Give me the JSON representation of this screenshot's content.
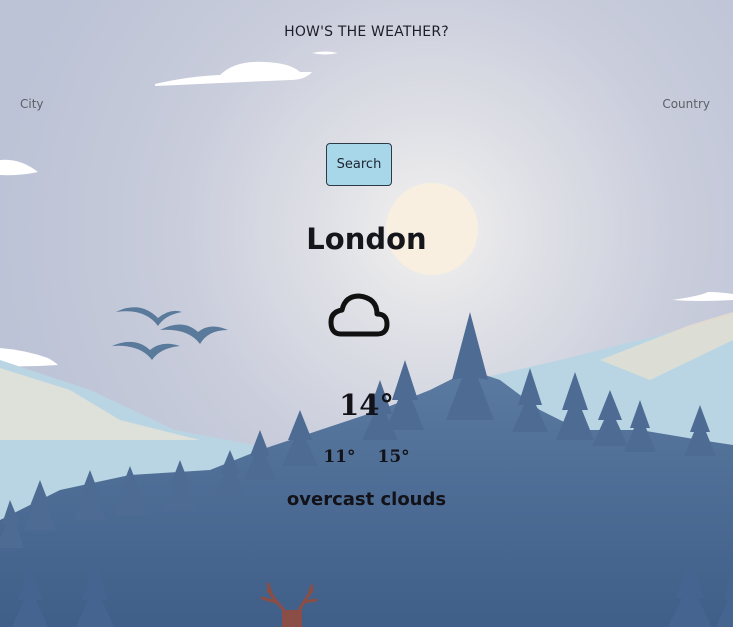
{
  "header": {
    "title": "HOW'S THE WEATHER?"
  },
  "search": {
    "city_placeholder": "City",
    "country_placeholder": "Country",
    "button_label": "Search"
  },
  "weather": {
    "city": "London",
    "icon": "cloud-icon",
    "temperature": "14°",
    "min": "11°",
    "max": "15°",
    "description": "overcast clouds"
  },
  "colors": {
    "button_bg": "#a9d7ea",
    "text": "#15151c",
    "sky": "#c6cad9",
    "forest": "#4f6d94"
  }
}
